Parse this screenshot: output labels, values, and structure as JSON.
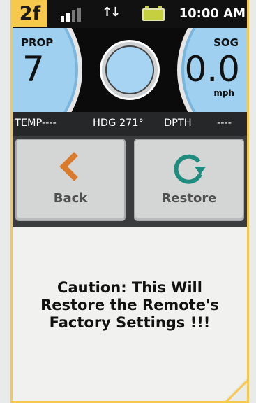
{
  "screen_tag": "2f",
  "status": {
    "time": "10:00 AM",
    "signal_bars": 4,
    "signal_bars_active": 2
  },
  "gauges": {
    "prop": {
      "label": "PROP",
      "value": "7"
    },
    "sog": {
      "label": "SOG",
      "value": "0.0",
      "unit": "mph"
    }
  },
  "readout": {
    "temp": "TEMP----",
    "hdg": "HDG 271°",
    "dpth": "DPTH",
    "dpth_value": "----"
  },
  "buttons": {
    "back": "Back",
    "restore": "Restore"
  },
  "message": "Caution: This Will\nRestore the Remote's\nFactory Settings !!!",
  "colors": {
    "accent": "#f6c94c",
    "gauge": "#9fd0ef",
    "back_icon": "#d97b2b",
    "restore_icon": "#1e8c7e"
  }
}
